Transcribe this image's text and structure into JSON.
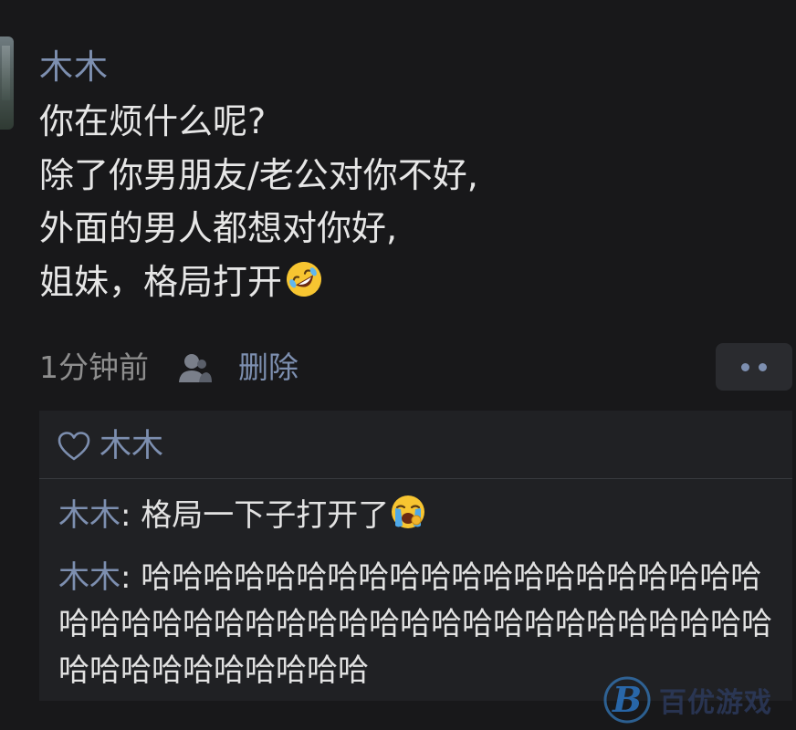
{
  "post": {
    "author": "木木",
    "lines": [
      "你在烦什么呢?",
      "除了你男朋友/老公对你不好,",
      "外面的男人都想对你好,",
      "姐妹，格局打开"
    ],
    "trailing_emoji": "rolling-on-floor-laughing-emoji"
  },
  "meta": {
    "time": "1分钟前",
    "visibility_icon": "person-icon",
    "delete_label": "删除",
    "more_icon": "more-dots-icon"
  },
  "likes": {
    "icon": "heart-icon",
    "names": "木木"
  },
  "comments": [
    {
      "author": "木木",
      "separator": ": ",
      "text": "格局一下子打开了",
      "emoji": "loudly-crying-emoji"
    },
    {
      "author": "木木",
      "separator": ": ",
      "text": "哈哈哈哈哈哈哈哈哈哈哈哈哈哈哈哈哈哈哈哈哈哈哈哈哈哈哈哈哈哈哈哈哈哈哈哈哈哈哈哈哈哈哈哈哈哈哈哈哈哈哈哈哈"
    }
  ],
  "watermark": {
    "logo": "B",
    "text": "百优游戏"
  },
  "colors": {
    "background": "#18181a",
    "accent_name": "#7d8fb0",
    "body_text": "#e6e6e6",
    "meta_text": "#8e8e8e",
    "panel": "#202124"
  }
}
